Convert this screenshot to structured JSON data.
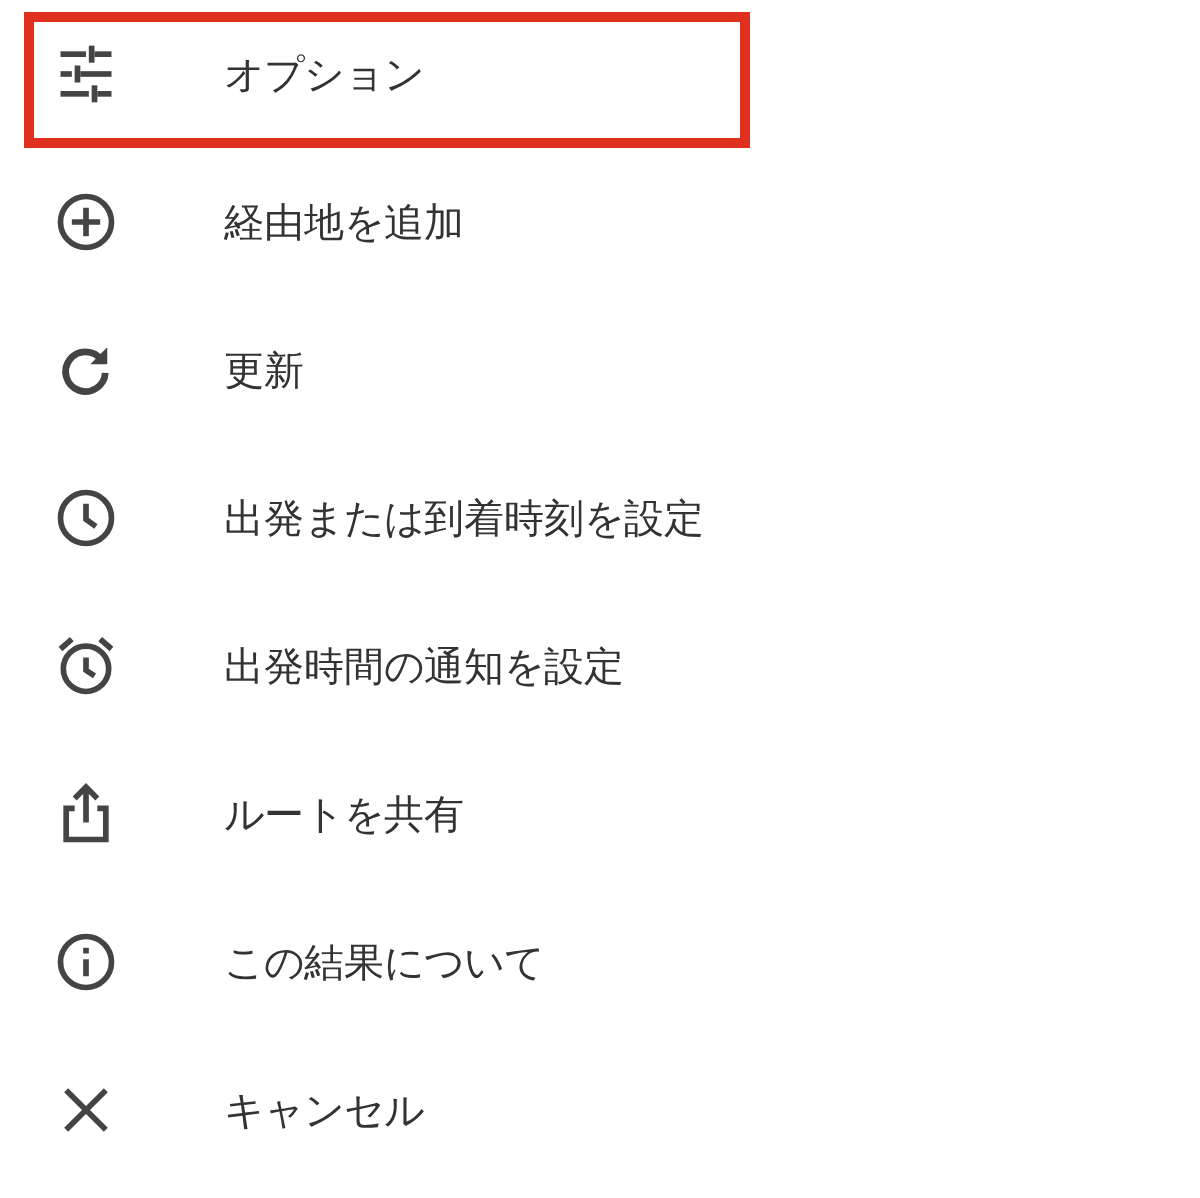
{
  "menu": {
    "items": [
      {
        "kind": "options",
        "label": "オプション",
        "highlighted": true
      },
      {
        "kind": "add",
        "label": "経由地を追加",
        "highlighted": false
      },
      {
        "kind": "refresh",
        "label": "更新",
        "highlighted": false
      },
      {
        "kind": "clock",
        "label": "出発または到着時刻を設定",
        "highlighted": false
      },
      {
        "kind": "alarm",
        "label": "出発時間の通知を設定",
        "highlighted": false
      },
      {
        "kind": "share",
        "label": "ルートを共有",
        "highlighted": false
      },
      {
        "kind": "info",
        "label": "この結果について",
        "highlighted": false
      },
      {
        "kind": "close",
        "label": "キャンセル",
        "highlighted": false
      }
    ]
  }
}
